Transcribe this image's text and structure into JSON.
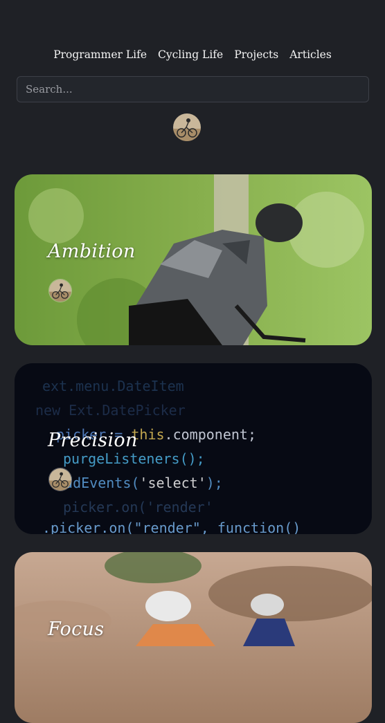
{
  "nav": {
    "items": [
      "Programmer Life",
      "Cycling Life",
      "Projects",
      "Articles"
    ]
  },
  "search": {
    "placeholder": "Search..."
  },
  "posts": [
    {
      "title": "Ambition",
      "image": "cyclist-forest-photo"
    },
    {
      "title": "Precision",
      "image": "code-screen-photo"
    },
    {
      "title": "Focus",
      "image": "cyclists-racing-photo"
    }
  ],
  "colors": {
    "background": "#1f2126",
    "search_bg": "#23262c",
    "text": "#f4f4f4"
  }
}
